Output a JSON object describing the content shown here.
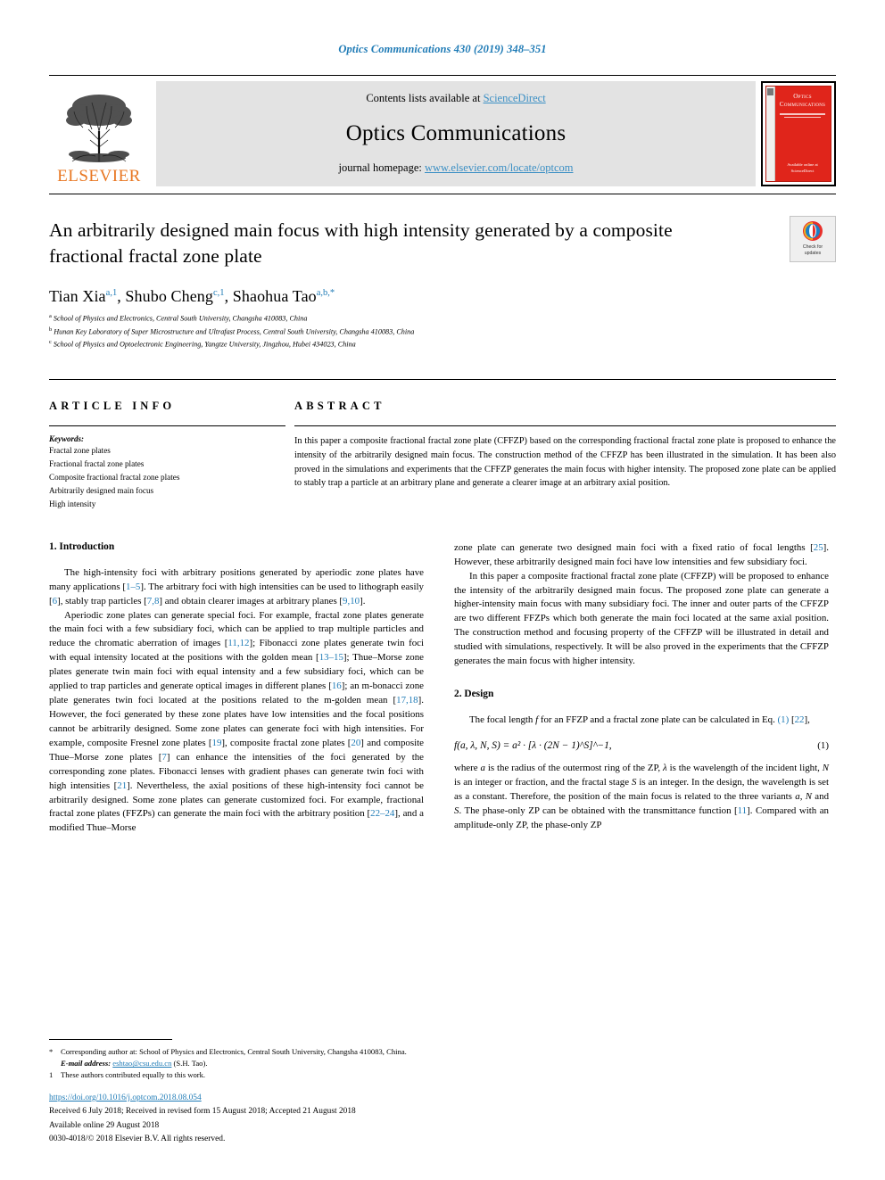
{
  "running_head": "Optics Communications 430 (2019) 348–351",
  "masthead": {
    "publisher": "ELSEVIER",
    "contents_prefix": "Contents lists available at ",
    "contents_link": "ScienceDirect",
    "journal_title": "Optics Communications",
    "homepage_prefix": "journal homepage: ",
    "homepage_url": "www.elsevier.com/locate/optcom",
    "cover": {
      "title_line1": "Optics",
      "title_line2": "Communications",
      "foot_line1": "Available online at",
      "foot_line2": "ScienceDirect"
    }
  },
  "title": "An arbitrarily designed main focus with high intensity generated by a composite fractional fractal zone plate",
  "crossmark": {
    "line1": "Check for",
    "line2": "updates"
  },
  "authors": [
    {
      "name": "Tian Xia",
      "marks": "a,1",
      "sep": ", "
    },
    {
      "name": "Shubo Cheng",
      "marks": "c,1",
      "sep": ", "
    },
    {
      "name": "Shaohua Tao",
      "marks": "a,b,*",
      "sep": ""
    }
  ],
  "affiliations": [
    {
      "mark": "a",
      "text": "School of Physics and Electronics, Central South University, Changsha 410083, China"
    },
    {
      "mark": "b",
      "text": "Hunan Key Laboratory of Super Microstructure and Ultrafast Process, Central South University, Changsha 410083, China"
    },
    {
      "mark": "c",
      "text": "School of Physics and Optoelectronic Engineering, Yangtze University, Jingzhou, Hubei 434023, China"
    }
  ],
  "article_info": {
    "heading": "ARTICLE INFO",
    "keywords_label": "Keywords:",
    "keywords": [
      "Fractal zone plates",
      "Fractional fractal zone plates",
      "Composite fractional fractal zone plates",
      "Arbitrarily designed main focus",
      "High intensity"
    ]
  },
  "abstract": {
    "heading": "ABSTRACT",
    "text": "In this paper a composite fractional fractal zone plate (CFFZP) based on the corresponding fractional fractal zone plate is proposed to enhance the intensity of the arbitrarily designed main focus. The construction method of the CFFZP has been illustrated in the simulation. It has been also proved in the simulations and experiments that the CFFZP generates the main focus with higher intensity. The proposed zone plate can be applied to stably trap a particle at an arbitrary plane and generate a clearer image at an arbitrary axial position."
  },
  "sections": {
    "introduction_heading": "1. Introduction",
    "design_heading": "2. Design"
  },
  "body": {
    "left": {
      "p1": [
        {
          "t": "The high-intensity foci with arbitrary positions generated by aperiodic zone plates have many applications ["
        },
        {
          "t": "1–5",
          "ref": true
        },
        {
          "t": "]. The arbitrary foci with high intensities can be used to lithograph easily ["
        },
        {
          "t": "6",
          "ref": true
        },
        {
          "t": "], stably trap particles ["
        },
        {
          "t": "7,8",
          "ref": true
        },
        {
          "t": "] and obtain clearer images at arbitrary planes ["
        },
        {
          "t": "9,10",
          "ref": true
        },
        {
          "t": "]."
        }
      ],
      "p2": [
        {
          "t": "Aperiodic zone plates can generate special foci. For example, fractal zone plates generate the main foci with a few subsidiary foci, which can be applied to trap multiple particles and reduce the chromatic aberration of images ["
        },
        {
          "t": "11,12",
          "ref": true
        },
        {
          "t": "]; Fibonacci zone plates generate twin foci with equal intensity located at the positions with the golden mean ["
        },
        {
          "t": "13–15",
          "ref": true
        },
        {
          "t": "]; Thue–Morse zone plates generate twin main foci with equal intensity and a few subsidiary foci, which can be applied to trap particles and generate optical images in different planes ["
        },
        {
          "t": "16",
          "ref": true
        },
        {
          "t": "]; an m-bonacci zone plate generates twin foci located at the positions related to the m-golden mean ["
        },
        {
          "t": "17,18",
          "ref": true
        },
        {
          "t": "]. However, the foci generated by these zone plates have low intensities and the focal positions cannot be arbitrarily designed. Some zone plates can generate foci with high intensities. For example, composite Fresnel zone plates ["
        },
        {
          "t": "19",
          "ref": true
        },
        {
          "t": "], composite fractal zone plates ["
        },
        {
          "t": "20",
          "ref": true
        },
        {
          "t": "] and composite Thue–Morse zone plates ["
        },
        {
          "t": "7",
          "ref": true
        },
        {
          "t": "] can enhance the intensities of the foci generated by the corresponding zone plates. Fibonacci lenses with gradient phases can generate twin foci with high intensities ["
        },
        {
          "t": "21",
          "ref": true
        },
        {
          "t": "]. Nevertheless, the axial positions of these high-intensity foci cannot be arbitrarily designed. Some zone plates can generate customized foci. For example, fractional fractal zone plates (FFZPs) can generate the main foci with the arbitrary position ["
        },
        {
          "t": "22–24",
          "ref": true
        },
        {
          "t": "], and a modified Thue–Morse"
        }
      ]
    },
    "right": {
      "p1": [
        {
          "t": "zone plate can generate two designed main foci with a fixed ratio of focal lengths ["
        },
        {
          "t": "25",
          "ref": true
        },
        {
          "t": "]. However, these arbitrarily designed main foci have low intensities and few subsidiary foci."
        }
      ],
      "p2": [
        {
          "t": "In this paper a composite fractional fractal zone plate (CFFZP) will be proposed to enhance the intensity of the arbitrarily designed main focus. The proposed zone plate can generate a higher-intensity main focus with many subsidiary foci. The inner and outer parts of the CFFZP are two different FFZPs which both generate the main foci located at the same axial position. The construction method and focusing property of the CFFZP will be illustrated in detail and studied with simulations, respectively. It will be also proved in the experiments that the CFFZP generates the main focus with higher intensity."
        }
      ],
      "p3": [
        {
          "t": "The focal length "
        },
        {
          "t": "f",
          "italic": true
        },
        {
          "t": " for an FFZP and a fractal zone plate  can be calculated in Eq. "
        },
        {
          "t": "(1)",
          "ref": true
        },
        {
          "t": " ["
        },
        {
          "t": "22",
          "ref": true
        },
        {
          "t": "],"
        }
      ],
      "equation": {
        "lhs": "f(a, λ, N, S)",
        "rhs": "= a² · [λ · (2N − 1)^S]^−1,",
        "number": "(1)"
      },
      "p4": [
        {
          "t": "where "
        },
        {
          "t": "a",
          "italic": true
        },
        {
          "t": " is the radius of the outermost ring of the ZP, "
        },
        {
          "t": "λ",
          "italic": true
        },
        {
          "t": " is the wavelength of the incident light, "
        },
        {
          "t": "N",
          "italic": true
        },
        {
          "t": " is an integer or fraction, and the fractal stage "
        },
        {
          "t": "S",
          "italic": true
        },
        {
          "t": " is an integer. In the design, the wavelength is set as a constant. Therefore, the position of the main focus is related to the three variants "
        },
        {
          "t": "a",
          "italic": true
        },
        {
          "t": ", "
        },
        {
          "t": "N",
          "italic": true
        },
        {
          "t": " and "
        },
        {
          "t": "S",
          "italic": true
        },
        {
          "t": ". The phase-only ZP can be obtained with the transmittance function ["
        },
        {
          "t": "11",
          "ref": true
        },
        {
          "t": "]. Compared with an amplitude-only ZP, the phase-only ZP"
        }
      ]
    }
  },
  "footnotes": {
    "corresponding": {
      "mark": "*",
      "text": "Corresponding author at: School of Physics and Electronics, Central South University, Changsha 410083, China."
    },
    "email": {
      "label": "E-mail address:",
      "address": "eshtao@csu.edu.cn",
      "suffix": " (S.H. Tao)."
    },
    "equal": {
      "mark": "1",
      "text": "These authors contributed equally to this work."
    }
  },
  "publication": {
    "doi": "https://doi.org/10.1016/j.optcom.2018.08.054",
    "received": "Received 6 July 2018; Received in revised form 15 August 2018; Accepted 21 August 2018",
    "available": "Available online 29 August 2018",
    "copyright": "0030-4018/© 2018 Elsevier B.V. All rights reserved."
  }
}
